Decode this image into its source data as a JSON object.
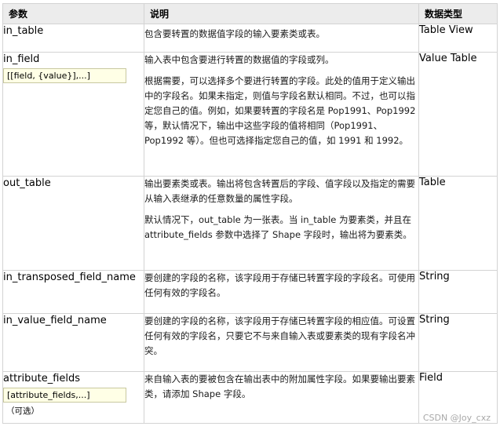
{
  "header": {
    "col1": "参数",
    "col2": "说明",
    "col3": "数据类型"
  },
  "rows": [
    {
      "name": "in_table",
      "desc": [
        "包含要转置的数据值字段的输入要素类或表。"
      ],
      "type": "Table View"
    },
    {
      "name": "in_field",
      "syntax": "[[field, {value}],...]",
      "desc": [
        "输入表中包含要进行转置的数据值的字段或列。",
        "根据需要，可以选择多个要进行转置的字段。此处的值用于定义输出中的字段名。如果未指定，则值与字段名默认相同。不过，也可以指定您自己的值。例如，如果要转置的字段名是 Pop1991、Pop1992 等，默认情况下，输出中这些字段的值将相同（Pop1991、Pop1992 等）。但也可选择指定您自己的值，如 1991 和 1992。"
      ],
      "type": "Value Table"
    },
    {
      "name": "out_table",
      "desc": [
        "输出要素类或表。输出将包含转置后的字段、值字段以及指定的需要从输入表继承的任意数量的属性字段。",
        "默认情况下，out_table 为一张表。当 in_table 为要素类，并且在 attribute_fields 参数中选择了 Shape 字段时，输出将为要素类。"
      ],
      "type": "Table"
    },
    {
      "name": "in_transposed_field_name",
      "desc": [
        "要创建的字段的名称，该字段用于存储已转置字段的字段名。可使用任何有效的字段名。"
      ],
      "type": "String"
    },
    {
      "name": "in_value_field_name",
      "desc": [
        "要创建的字段的名称，该字段用于存储已转置字段的相应值。可设置任何有效的字段名，只要它不与来自输入表或要素类的现有字段名冲突。"
      ],
      "type": "String"
    },
    {
      "name": "attribute_fields",
      "syntax": "[attribute_fields,...]",
      "optional": "（可选）",
      "desc": [
        "来自输入表的要被包含在输出表中的附加属性字段。如果要输出要素类，请添加 Shape 字段。"
      ],
      "type": "Field"
    }
  ],
  "watermark": "CSDN @Joy_cxz"
}
